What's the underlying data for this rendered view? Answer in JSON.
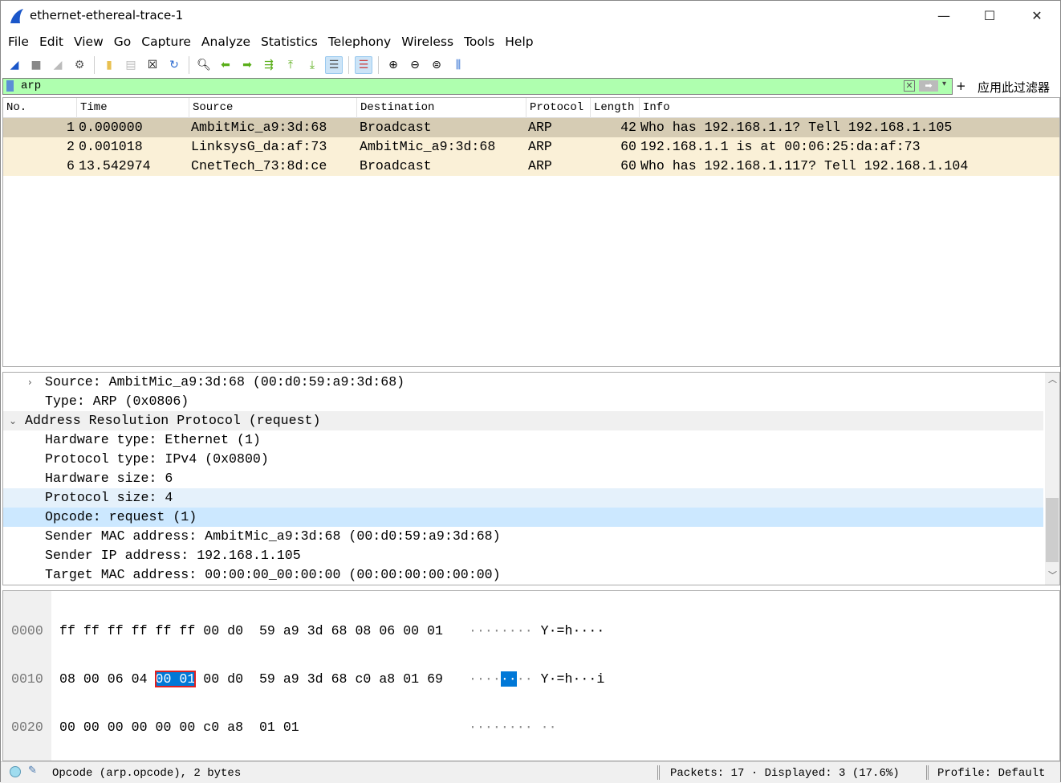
{
  "window": {
    "title": "ethernet-ethereal-trace-1",
    "minimize": "—",
    "maximize": "☐",
    "close": "✕"
  },
  "menu": [
    "File",
    "Edit",
    "View",
    "Go",
    "Capture",
    "Analyze",
    "Statistics",
    "Telephony",
    "Wireless",
    "Tools",
    "Help"
  ],
  "toolbar": [
    "start-capture",
    "stop-capture",
    "restart-capture",
    "capture-options",
    "open-file",
    "save-file",
    "close-file",
    "reload-file",
    "find-packet",
    "go-back",
    "go-forward",
    "go-to-packet",
    "go-first",
    "go-last",
    "auto-scroll",
    "colorize",
    "zoom-in",
    "zoom-out",
    "zoom-normal",
    "resize-columns"
  ],
  "filter": {
    "value": "arp",
    "label": "应用此过滤器",
    "plus": "+"
  },
  "packet_list": {
    "columns": [
      "No.",
      "Time",
      "Source",
      "Destination",
      "Protocol",
      "Length",
      "Info"
    ],
    "rows": [
      {
        "no": "1",
        "time": "0.000000",
        "source": "AmbitMic_a9:3d:68",
        "destination": "Broadcast",
        "protocol": "ARP",
        "length": "42",
        "info": "Who has 192.168.1.1? Tell 192.168.1.105"
      },
      {
        "no": "2",
        "time": "0.001018",
        "source": "LinksysG_da:af:73",
        "destination": "AmbitMic_a9:3d:68",
        "protocol": "ARP",
        "length": "60",
        "info": "192.168.1.1 is at 00:06:25:da:af:73"
      },
      {
        "no": "6",
        "time": "13.542974",
        "source": "CnetTech_73:8d:ce",
        "destination": "Broadcast",
        "protocol": "ARP",
        "length": "60",
        "info": "Who has 192.168.1.117? Tell 192.168.1.104"
      }
    ],
    "colors": {
      "selected": "#d6ccb4",
      "arp": "#faf0d7"
    }
  },
  "details": [
    "Source: AmbitMic_a9:3d:68 (00:d0:59:a9:3d:68)",
    "Type: ARP (0x0806)",
    "Address Resolution Protocol (request)",
    "Hardware type: Ethernet (1)",
    "Protocol type: IPv4 (0x0800)",
    "Hardware size: 6",
    "Protocol size: 4",
    "Opcode: request (1)",
    "Sender MAC address: AmbitMic_a9:3d:68 (00:d0:59:a9:3d:68)",
    "Sender IP address: 192.168.1.105",
    "Target MAC address: 00:00:00_00:00:00 (00:00:00:00:00:00)"
  ],
  "bytes": [
    {
      "offset": "0000",
      "hex": "ff ff ff ff ff ff 00 d0  59 a9 3d 68 08 06 00 01",
      "ascii_a": "········",
      "ascii_b": " Y·=h····"
    },
    {
      "offset": "0010",
      "hex_pre": "08 00 06 04 ",
      "hex_sel": "00 01",
      "hex_post": " 00 d0  59 a9 3d 68 c0 a8 01 69",
      "ascii_pre": "····",
      "ascii_sel": "··",
      "ascii_post": "··",
      "ascii_b": " Y·=h···i"
    },
    {
      "offset": "0020",
      "hex": "00 00 00 00 00 00 c0 a8  01 01",
      "ascii_a": "········",
      "ascii_b": " ··"
    }
  ],
  "status": {
    "field": "Opcode (arp.opcode), 2 bytes",
    "packets": "Packets: 17 · Displayed: 3 (17.6%)",
    "profile": "Profile: Default"
  }
}
